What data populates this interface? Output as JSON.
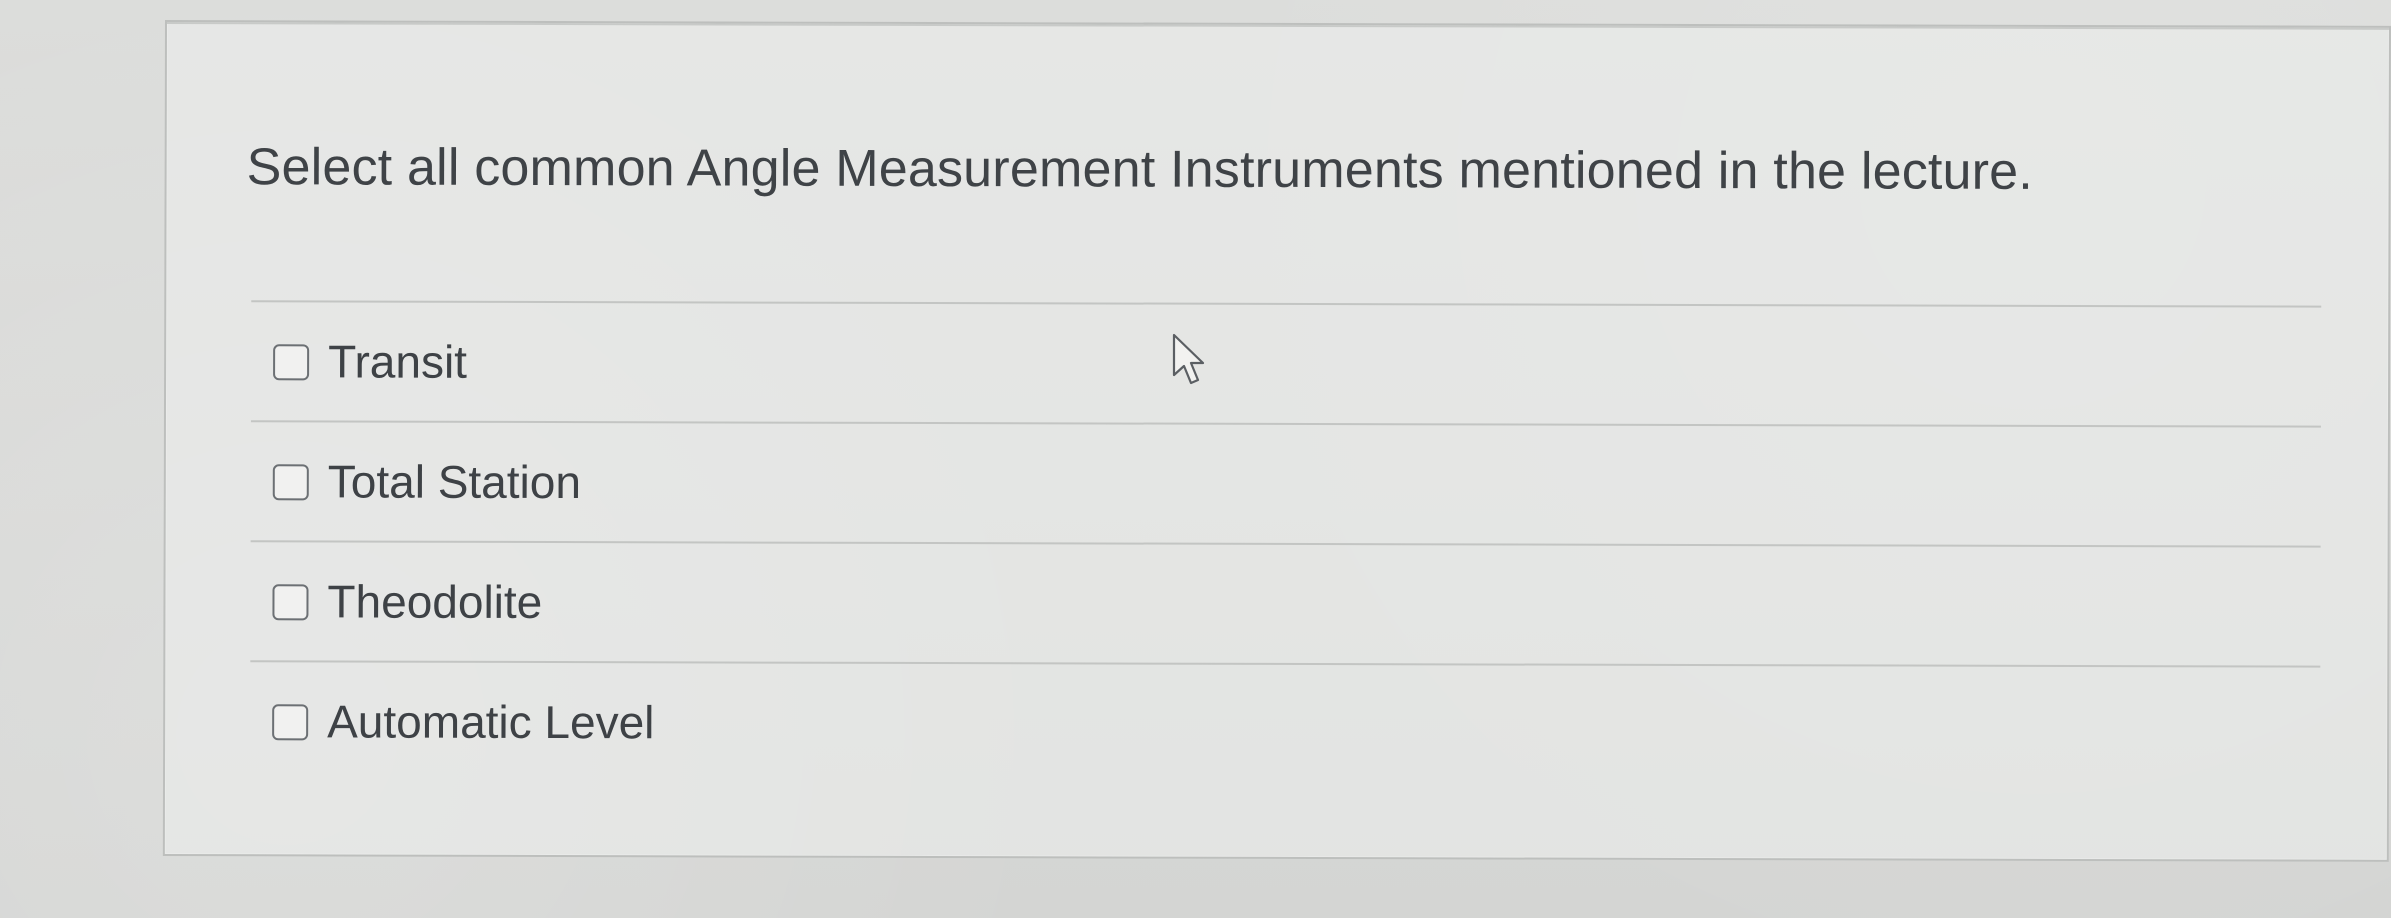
{
  "question": {
    "text": "Select all common Angle Measurement Instruments mentioned in the lecture."
  },
  "options": [
    {
      "label": "Transit"
    },
    {
      "label": "Total Station"
    },
    {
      "label": "Theodolite"
    },
    {
      "label": "Automatic Level"
    }
  ],
  "ui": {
    "cursor_icon": "mouse-pointer-icon"
  }
}
